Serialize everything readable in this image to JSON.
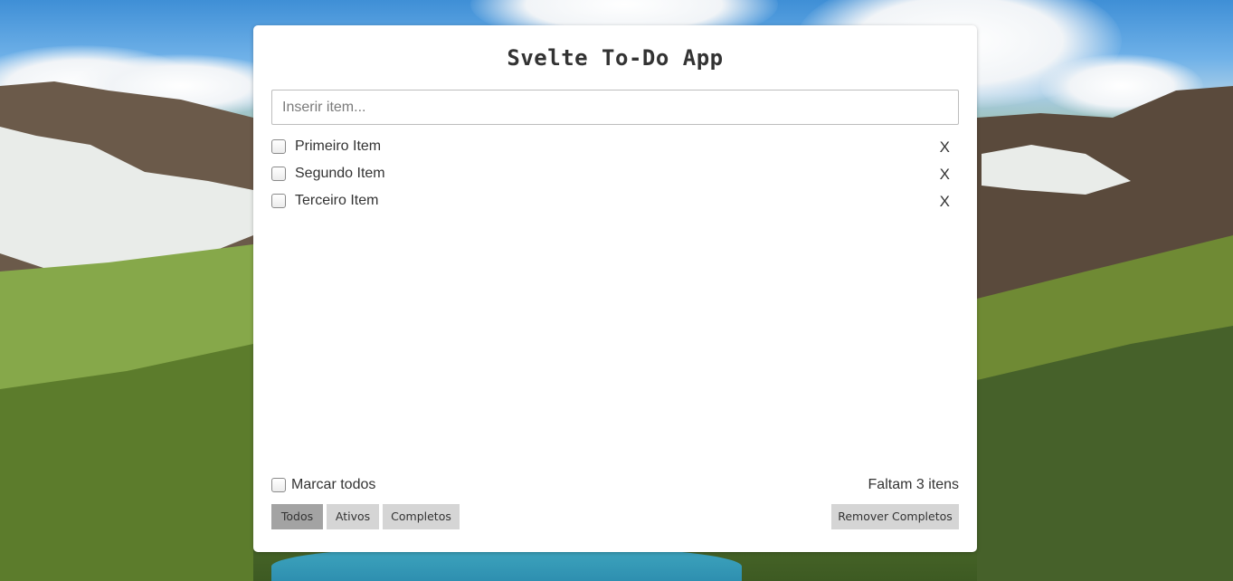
{
  "app": {
    "title": "Svelte To-Do App"
  },
  "new_item": {
    "placeholder": "Inserir item...",
    "value": ""
  },
  "todos": [
    {
      "label": "Primeiro Item",
      "done": false,
      "remove_label": "X"
    },
    {
      "label": "Segundo Item",
      "done": false,
      "remove_label": "X"
    },
    {
      "label": "Terceiro Item",
      "done": false,
      "remove_label": "X"
    }
  ],
  "footer": {
    "mark_all_label": "Marcar todos",
    "remaining_text": "Faltam 3 itens"
  },
  "filters": [
    {
      "label": "Todos",
      "active": true
    },
    {
      "label": "Ativos",
      "active": false
    },
    {
      "label": "Completos",
      "active": false
    }
  ],
  "actions": {
    "remove_completed_label": "Remover Completos"
  },
  "colors": {
    "card_background": "#ffffff",
    "button_background": "#d5d5d5",
    "button_active_background": "#a3a3a3",
    "text": "#333333"
  }
}
